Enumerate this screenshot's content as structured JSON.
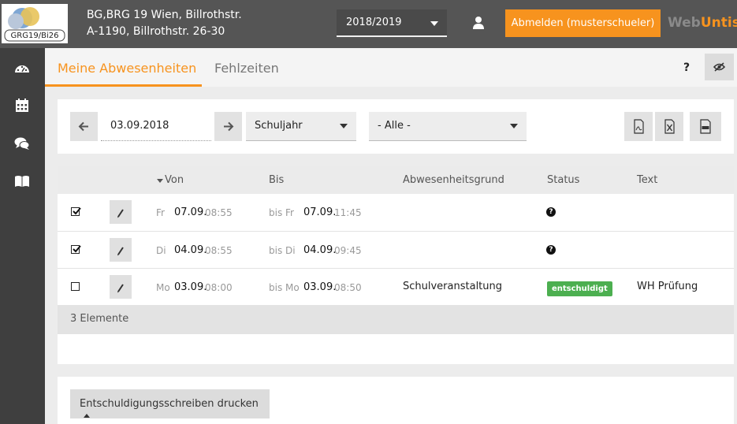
{
  "header": {
    "logo_text": "GRG19/Bi26",
    "school_line1": "BG,BRG 19 Wien, Billrothstr.",
    "school_line2": "A-1190, Billrothstr. 26-30",
    "year": "2018/2019",
    "logout": "Abmelden (musterschueler)",
    "brand_part1": "Web",
    "brand_part2": "Untis",
    "accent_color": "#f7931e"
  },
  "sidebar": {
    "icons": [
      "dashboard-icon",
      "calendar-icon",
      "chat-icon",
      "book-icon"
    ]
  },
  "tabs": {
    "active": "Meine Abwesenheiten",
    "inactive": "Fehlzeiten",
    "help": "?"
  },
  "filter": {
    "date": "03.09.2018",
    "range": "Schuljahr",
    "filter": "- Alle -",
    "exports": [
      "pdf-icon",
      "excel-icon",
      "csv-icon"
    ]
  },
  "table": {
    "headers": {
      "von": "Von",
      "bis": "Bis",
      "grund": "Abwesenheitsgrund",
      "status": "Status",
      "text": "Text"
    },
    "rows": [
      {
        "checked": true,
        "von_dow": "Fr",
        "von_date": "07.09.",
        "von_time": "08:55",
        "bis_dow": "bis Fr",
        "bis_date": "07.09.",
        "bis_time": "11:45",
        "reason": "",
        "status": "?",
        "text": ""
      },
      {
        "checked": true,
        "von_dow": "Di",
        "von_date": "04.09.",
        "von_time": "08:55",
        "bis_dow": "bis Di",
        "bis_date": "04.09.",
        "bis_time": "09:45",
        "reason": "",
        "status": "?",
        "text": ""
      },
      {
        "checked": false,
        "von_dow": "Mo",
        "von_date": "03.09.",
        "von_time": "08:00",
        "bis_dow": "bis Mo",
        "bis_date": "03.09.",
        "bis_time": "08:50",
        "reason": "Schulveranstaltung",
        "status": "entschuldigt",
        "text": "WH Prüfung"
      }
    ],
    "count": "3 Elemente"
  },
  "bottom": {
    "print": "Entschuldigungsschreiben drucken"
  }
}
